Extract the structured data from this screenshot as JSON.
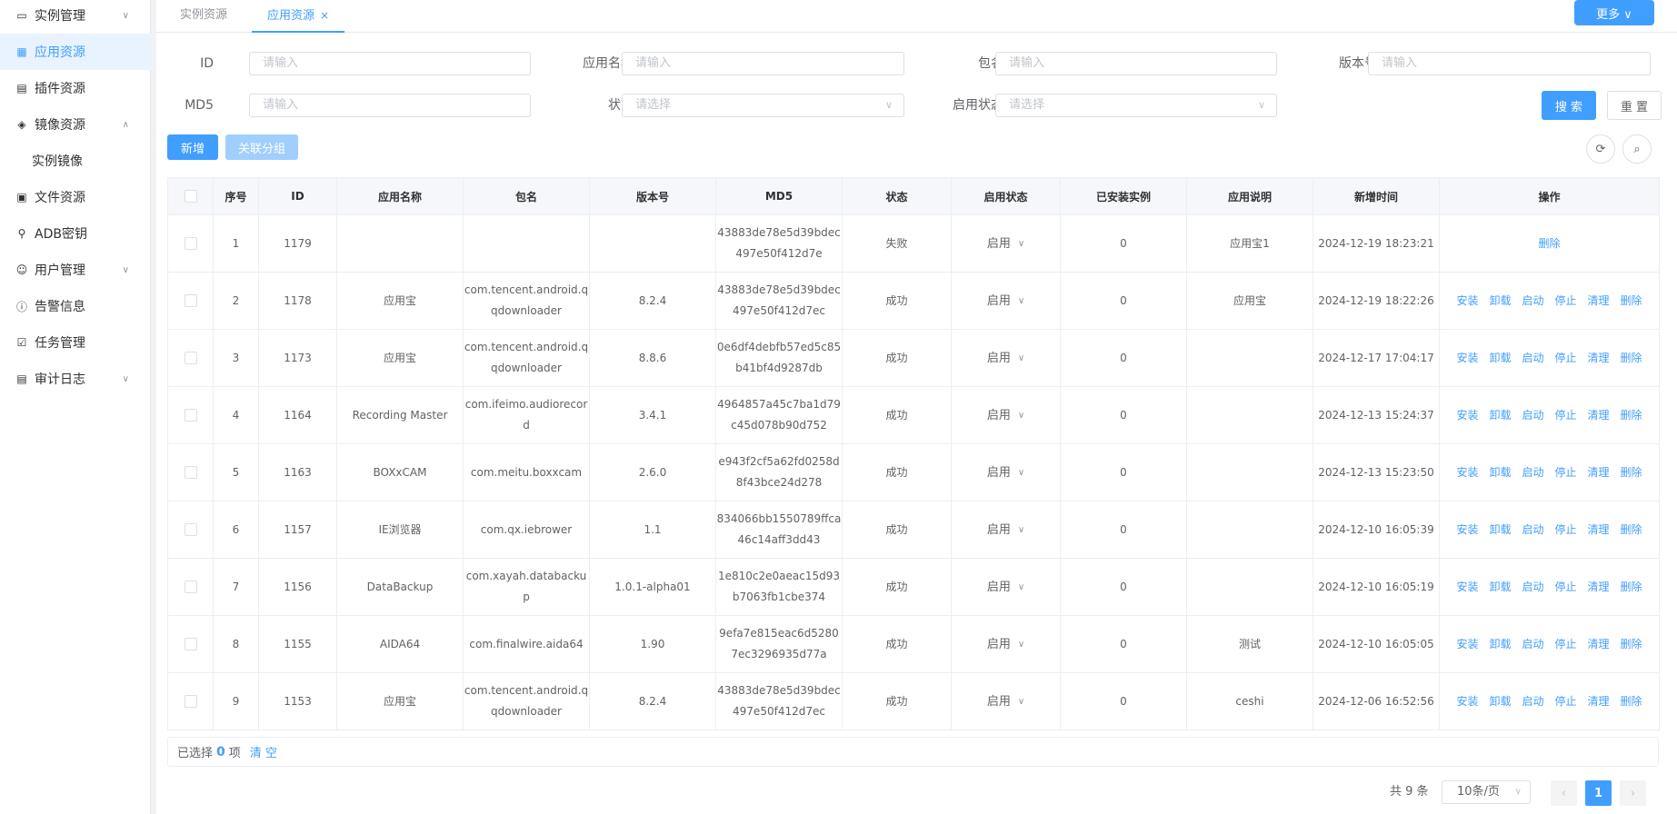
{
  "sidebar": {
    "items": [
      {
        "label": "实例管理",
        "icon": "monitor-icon",
        "arrow": "∨"
      },
      {
        "label": "应用资源",
        "icon": "grid-icon",
        "active": true
      },
      {
        "label": "插件资源",
        "icon": "document-icon"
      },
      {
        "label": "镜像资源",
        "icon": "tag-icon",
        "arrow": "∧"
      },
      {
        "label": "实例镜像",
        "sub": true
      },
      {
        "label": "文件资源",
        "icon": "wallet-icon"
      },
      {
        "label": "ADB密钥",
        "icon": "key-icon"
      },
      {
        "label": "用户管理",
        "icon": "user-icon",
        "arrow": "∨"
      },
      {
        "label": "告警信息",
        "icon": "info-icon"
      },
      {
        "label": "任务管理",
        "icon": "checkbox-icon"
      },
      {
        "label": "审计日志",
        "icon": "log-icon",
        "arrow": "∨"
      }
    ]
  },
  "tabs": [
    {
      "label": "实例资源"
    },
    {
      "label": "应用资源",
      "close": "×"
    }
  ],
  "more_button": "更多 ∨",
  "filters": {
    "id": {
      "label": "ID",
      "placeholder": "请输入"
    },
    "app_name": {
      "label": "应用名称",
      "placeholder": "请输入"
    },
    "package": {
      "label": "包名",
      "placeholder": "请输入"
    },
    "version": {
      "label": "版本号",
      "placeholder": "请输入"
    },
    "md5": {
      "label": "MD5",
      "placeholder": "请输入"
    },
    "status": {
      "label": "状态",
      "placeholder": "请选择"
    },
    "enable_status": {
      "label": "启用状态",
      "placeholder": "请选择"
    },
    "search_button": "搜 索",
    "reset_button": "重 置"
  },
  "toolbar": {
    "add_button": "新增",
    "group_button": "关联分组"
  },
  "table": {
    "columns": [
      "序号",
      "ID",
      "应用名称",
      "包名",
      "版本号",
      "MD5",
      "状态",
      "启用状态",
      "已安装实例",
      "应用说明",
      "新增时间",
      "操作"
    ],
    "rows": [
      {
        "no": "1",
        "id": "1179",
        "name": "",
        "pkg": "",
        "ver": "",
        "md5": "43883de78e5d39bdec497e50f412d7e",
        "status": "失败",
        "enable": "启用",
        "installed": "0",
        "desc": "应用宝1",
        "time": "2024-12-19 18:23:21",
        "ops": [
          "删除"
        ]
      },
      {
        "no": "2",
        "id": "1178",
        "name": "应用宝",
        "pkg": "com.tencent.android.qqdownloader",
        "ver": "8.2.4",
        "md5": "43883de78e5d39bdec497e50f412d7ec",
        "status": "成功",
        "enable": "启用",
        "installed": "0",
        "desc": "应用宝",
        "time": "2024-12-19 18:22:26",
        "ops": [
          "安装",
          "卸载",
          "启动",
          "停止",
          "清理",
          "删除"
        ]
      },
      {
        "no": "3",
        "id": "1173",
        "name": "应用宝",
        "pkg": "com.tencent.android.qqdownloader",
        "ver": "8.8.6",
        "md5": "0e6df4debfb57ed5c85b41bf4d9287db",
        "status": "成功",
        "enable": "启用",
        "installed": "0",
        "desc": "",
        "time": "2024-12-17 17:04:17",
        "ops": [
          "安装",
          "卸载",
          "启动",
          "停止",
          "清理",
          "删除"
        ]
      },
      {
        "no": "4",
        "id": "1164",
        "name": "Recording Master",
        "pkg": "com.ifeimo.audiorecord",
        "ver": "3.4.1",
        "md5": "4964857a45c7ba1d79c45d078b90d752",
        "status": "成功",
        "enable": "启用",
        "installed": "0",
        "desc": "",
        "time": "2024-12-13 15:24:37",
        "ops": [
          "安装",
          "卸载",
          "启动",
          "停止",
          "清理",
          "删除"
        ]
      },
      {
        "no": "5",
        "id": "1163",
        "name": "BOXxCAM",
        "pkg": "com.meitu.boxxcam",
        "ver": "2.6.0",
        "md5": "e943f2cf5a62fd0258d8f43bce24d278",
        "status": "成功",
        "enable": "启用",
        "installed": "0",
        "desc": "",
        "time": "2024-12-13 15:23:50",
        "ops": [
          "安装",
          "卸载",
          "启动",
          "停止",
          "清理",
          "删除"
        ]
      },
      {
        "no": "6",
        "id": "1157",
        "name": "IE浏览器",
        "pkg": "com.qx.iebrower",
        "ver": "1.1",
        "md5": "834066bb1550789ffca46c14aff3dd43",
        "status": "成功",
        "enable": "启用",
        "installed": "0",
        "desc": "",
        "time": "2024-12-10 16:05:39",
        "ops": [
          "安装",
          "卸载",
          "启动",
          "停止",
          "清理",
          "删除"
        ]
      },
      {
        "no": "7",
        "id": "1156",
        "name": "DataBackup",
        "pkg": "com.xayah.databackup",
        "ver": "1.0.1-alpha01",
        "md5": "1e810c2e0aeac15d93b7063fb1cbe374",
        "status": "成功",
        "enable": "启用",
        "installed": "0",
        "desc": "",
        "time": "2024-12-10 16:05:19",
        "ops": [
          "安装",
          "卸载",
          "启动",
          "停止",
          "清理",
          "删除"
        ]
      },
      {
        "no": "8",
        "id": "1155",
        "name": "AIDA64",
        "pkg": "com.finalwire.aida64",
        "ver": "1.90",
        "md5": "9efa7e815eac6d52807ec3296935d77a",
        "status": "成功",
        "enable": "启用",
        "installed": "0",
        "desc": "测试",
        "time": "2024-12-10 16:05:05",
        "ops": [
          "安装",
          "卸载",
          "启动",
          "停止",
          "清理",
          "删除"
        ]
      },
      {
        "no": "9",
        "id": "1153",
        "name": "应用宝",
        "pkg": "com.tencent.android.qqdownloader",
        "ver": "8.2.4",
        "md5": "43883de78e5d39bdec497e50f412d7ec",
        "status": "成功",
        "enable": "启用",
        "installed": "0",
        "desc": "ceshi",
        "time": "2024-12-06 16:52:56",
        "ops": [
          "安装",
          "卸载",
          "启动",
          "停止",
          "清理",
          "删除"
        ]
      }
    ]
  },
  "selection": {
    "prefix": "已选择",
    "count": "0",
    "suffix": "项",
    "clear": "清 空"
  },
  "pagination": {
    "total": "共 9 条",
    "page_size": "10条/页",
    "current": "1",
    "prev": "‹",
    "next": "›"
  },
  "colors": {
    "accent": "#409eff",
    "active_bg": "#e8f3ff",
    "disabled": "#a0cfff"
  }
}
